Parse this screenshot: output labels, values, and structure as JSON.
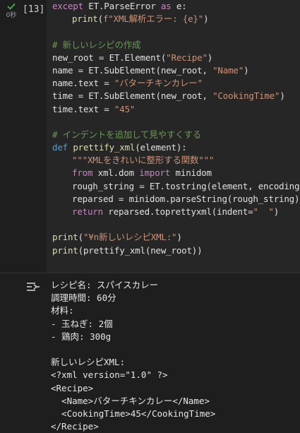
{
  "cell": {
    "exec_count": "[13]",
    "elapsed": "0秒",
    "code_lines": [
      {
        "indent": 0,
        "segments": [
          {
            "t": "except",
            "c": "kw"
          },
          {
            "t": " ET.ParseError ",
            "c": "id"
          },
          {
            "t": "as",
            "c": "kw"
          },
          {
            "t": " e:",
            "c": "id"
          }
        ]
      },
      {
        "indent": 1,
        "segments": [
          {
            "t": "print",
            "c": "fn"
          },
          {
            "t": "(",
            "c": "id"
          },
          {
            "t": "f\"XML解析エラー: {e}\"",
            "c": "str"
          },
          {
            "t": ")",
            "c": "id"
          }
        ]
      },
      {
        "indent": 0,
        "segments": []
      },
      {
        "indent": 0,
        "segments": [
          {
            "t": "# 新しいレシピの作成",
            "c": "cm"
          }
        ]
      },
      {
        "indent": 0,
        "segments": [
          {
            "t": "new_root = ET.Element(",
            "c": "id"
          },
          {
            "t": "\"Recipe\"",
            "c": "str"
          },
          {
            "t": ")",
            "c": "id"
          }
        ]
      },
      {
        "indent": 0,
        "segments": [
          {
            "t": "name = ET.SubElement(new_root, ",
            "c": "id"
          },
          {
            "t": "\"Name\"",
            "c": "str"
          },
          {
            "t": ")",
            "c": "id"
          }
        ]
      },
      {
        "indent": 0,
        "segments": [
          {
            "t": "name.text = ",
            "c": "id"
          },
          {
            "t": "\"バターチキンカレー\"",
            "c": "str"
          }
        ]
      },
      {
        "indent": 0,
        "segments": [
          {
            "t": "time = ET.SubElement(new_root, ",
            "c": "id"
          },
          {
            "t": "\"CookingTime\"",
            "c": "str"
          },
          {
            "t": ")",
            "c": "id"
          }
        ]
      },
      {
        "indent": 0,
        "segments": [
          {
            "t": "time.text = ",
            "c": "id"
          },
          {
            "t": "\"45\"",
            "c": "str"
          }
        ]
      },
      {
        "indent": 0,
        "segments": []
      },
      {
        "indent": 0,
        "segments": [
          {
            "t": "# インデントを追加して見やすくする",
            "c": "cm"
          }
        ]
      },
      {
        "indent": 0,
        "segments": [
          {
            "t": "def",
            "c": "kw2"
          },
          {
            "t": " ",
            "c": "id"
          },
          {
            "t": "prettify_xml",
            "c": "fn"
          },
          {
            "t": "(element):",
            "c": "id"
          }
        ]
      },
      {
        "indent": 1,
        "segments": [
          {
            "t": "\"\"\"XMLをきれいに整形する関数\"\"\"",
            "c": "str"
          }
        ]
      },
      {
        "indent": 1,
        "segments": [
          {
            "t": "from",
            "c": "kw"
          },
          {
            "t": " xml.dom ",
            "c": "id"
          },
          {
            "t": "import",
            "c": "kw"
          },
          {
            "t": " minidom",
            "c": "id"
          }
        ]
      },
      {
        "indent": 1,
        "segments": [
          {
            "t": "rough_string = ET.tostring(element, encoding='",
            "c": "id"
          }
        ]
      },
      {
        "indent": 1,
        "segments": [
          {
            "t": "reparsed = minidom.parseString(rough_string)",
            "c": "id"
          }
        ]
      },
      {
        "indent": 1,
        "segments": [
          {
            "t": "return",
            "c": "kw"
          },
          {
            "t": " reparsed.toprettyxml(indent=",
            "c": "id"
          },
          {
            "t": "\"  \"",
            "c": "str"
          },
          {
            "t": ")",
            "c": "id"
          }
        ]
      },
      {
        "indent": 0,
        "segments": []
      },
      {
        "indent": 0,
        "segments": [
          {
            "t": "print",
            "c": "fn"
          },
          {
            "t": "(",
            "c": "id"
          },
          {
            "t": "\"¥n新しいレシピXML:\"",
            "c": "str"
          },
          {
            "t": ")",
            "c": "id"
          }
        ]
      },
      {
        "indent": 0,
        "segments": [
          {
            "t": "print",
            "c": "fn"
          },
          {
            "t": "(prettify_xml(new_root))",
            "c": "id"
          }
        ]
      }
    ]
  },
  "output": {
    "icon": "output-toggle-icon",
    "lines": [
      "レシピ名: スパイスカレー",
      "調理時間: 60分",
      "材料:",
      "- 玉ねぎ: 2個",
      "- 鶏肉: 300g",
      "",
      "新しいレシピXML:",
      "<?xml version=\"1.0\" ?>",
      "<Recipe>",
      "  <Name>バターチキンカレー</Name>",
      "  <CookingTime>45</CookingTime>",
      "</Recipe>"
    ]
  },
  "colors": {
    "background": "#1e1e1e",
    "cell_background": "#262626",
    "success": "#4caf50",
    "keyword": "#c586c0",
    "string": "#ce9178",
    "comment": "#6a9955",
    "function": "#dcdcaa"
  }
}
